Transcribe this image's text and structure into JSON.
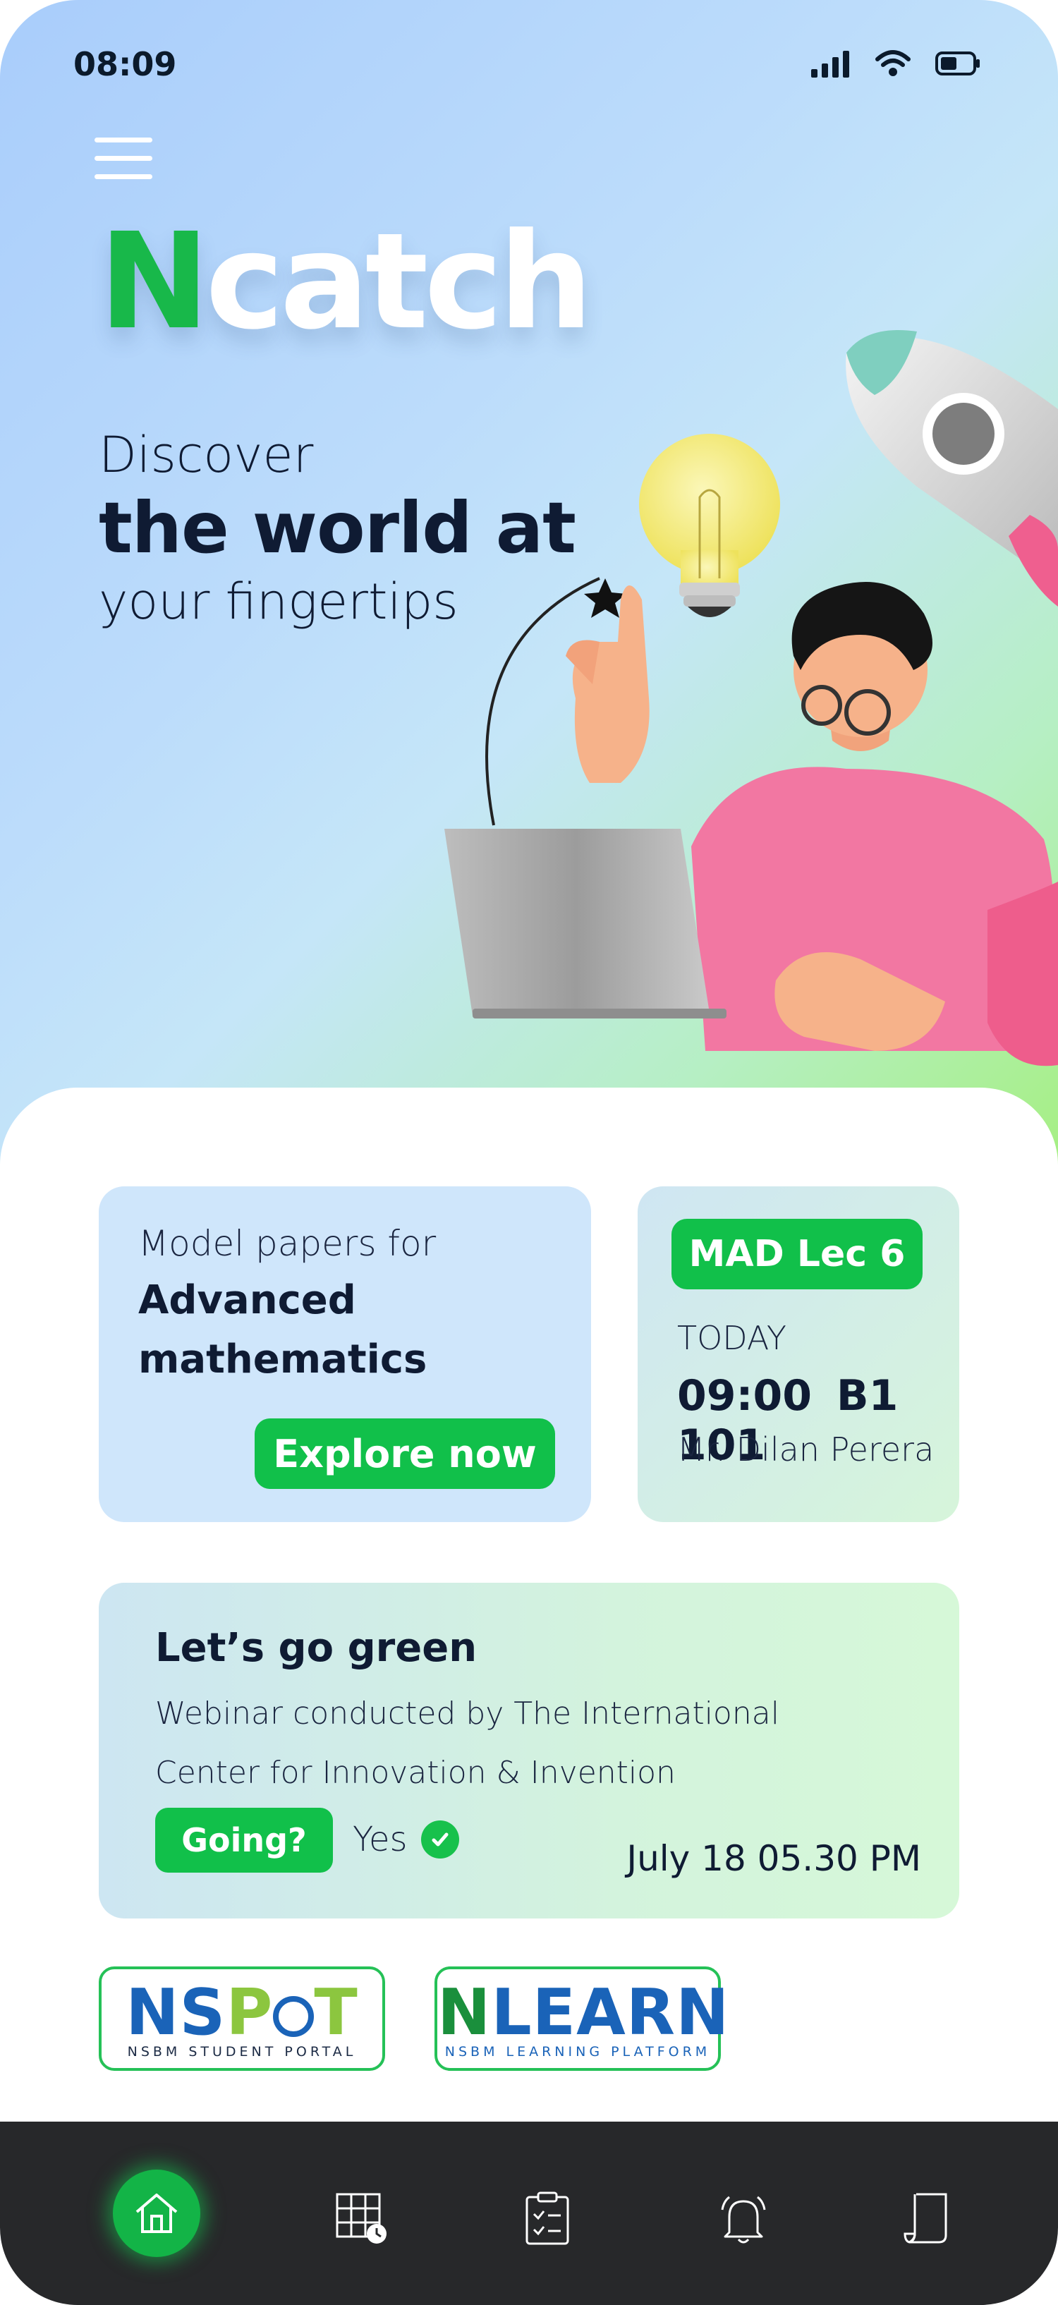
{
  "status_bar": {
    "time": "08:09",
    "icons": [
      "signal-icon",
      "wifi-icon",
      "battery-icon"
    ]
  },
  "header": {
    "menu_icon": "hamburger-menu-icon",
    "logo": {
      "first_letter": "N",
      "rest": "catch"
    }
  },
  "hero": {
    "line1": "Discover",
    "line2": "the world at",
    "line3": "your fingertips"
  },
  "cards": {
    "papers": {
      "subtitle": "Model papers for",
      "title_line1": "Advanced",
      "title_line2": "mathematics",
      "button": "Explore now"
    },
    "lecture": {
      "badge": "MAD Lec 6",
      "day": "TODAY",
      "time_room": "09:00  B1 101",
      "lecturer": "Mr. Dilan Perera"
    },
    "event": {
      "title": "Let’s go green",
      "desc_line1": "Webinar conducted by The International",
      "desc_line2": "Center for Innovation & Invention",
      "button": "Going?",
      "response": "Yes",
      "date": "July 18 05.30 PM"
    }
  },
  "platforms": {
    "nspot": {
      "logo": "NSPOT",
      "sub": "NSBM STUDENT PORTAL"
    },
    "nlearn": {
      "logo": "NLEARN",
      "sub": "NSBM LEARNING PLATFORM"
    }
  },
  "colors": {
    "accent_green": "#11c04a",
    "nav_background": "#27282a",
    "dark_text": "#0f1b33",
    "nspot_blue": "#1a63b8",
    "nlearn_blue": "#1a63b8",
    "nspot_green": "#8cc63f"
  },
  "nav": {
    "items": [
      "home-icon",
      "timetable-icon",
      "tasks-icon",
      "notifications-icon",
      "notes-icon"
    ],
    "active": "home-icon"
  }
}
